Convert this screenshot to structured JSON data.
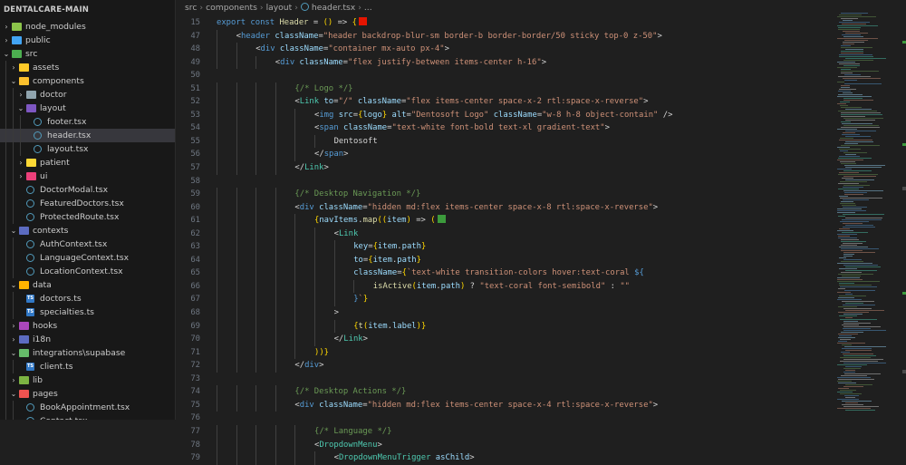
{
  "sidebar": {
    "title": "DENTALCARE-MAIN",
    "items": [
      {
        "label": "node_modules",
        "depth": 0,
        "kind": "folder",
        "open": false,
        "icon": "folder-green-icon",
        "color": "#8bc34a"
      },
      {
        "label": "public",
        "depth": 0,
        "kind": "folder",
        "open": false,
        "icon": "folder-blue-icon",
        "color": "#42a5f5"
      },
      {
        "label": "src",
        "depth": 0,
        "kind": "folder",
        "open": true,
        "icon": "folder-green-icon",
        "color": "#4caf50"
      },
      {
        "label": "assets",
        "depth": 1,
        "kind": "folder",
        "open": false,
        "icon": "folder-yellow-icon",
        "color": "#ffca28"
      },
      {
        "label": "components",
        "depth": 1,
        "kind": "folder",
        "open": true,
        "icon": "folder-yellow-icon",
        "color": "#fbc02d"
      },
      {
        "label": "doctor",
        "depth": 2,
        "kind": "folder",
        "open": false,
        "icon": "folder-grey-icon",
        "color": "#90a4ae"
      },
      {
        "label": "layout",
        "depth": 2,
        "kind": "folder",
        "open": true,
        "icon": "folder-purple-icon",
        "color": "#7e57c2"
      },
      {
        "label": "footer.tsx",
        "depth": 3,
        "kind": "react",
        "icon": "react-icon"
      },
      {
        "label": "header.tsx",
        "depth": 3,
        "kind": "react",
        "icon": "react-icon",
        "selected": true
      },
      {
        "label": "layout.tsx",
        "depth": 3,
        "kind": "react",
        "icon": "react-icon"
      },
      {
        "label": "patient",
        "depth": 2,
        "kind": "folder",
        "open": false,
        "icon": "folder-yellow-icon",
        "color": "#fdd835"
      },
      {
        "label": "ui",
        "depth": 2,
        "kind": "folder",
        "open": false,
        "icon": "folder-pink-icon",
        "color": "#ec407a"
      },
      {
        "label": "DoctorModal.tsx",
        "depth": 2,
        "kind": "react",
        "icon": "react-icon"
      },
      {
        "label": "FeaturedDoctors.tsx",
        "depth": 2,
        "kind": "react",
        "icon": "react-icon"
      },
      {
        "label": "ProtectedRoute.tsx",
        "depth": 2,
        "kind": "react",
        "icon": "react-icon"
      },
      {
        "label": "contexts",
        "depth": 1,
        "kind": "folder",
        "open": true,
        "icon": "folder-blue-icon",
        "color": "#5c6bc0"
      },
      {
        "label": "AuthContext.tsx",
        "depth": 2,
        "kind": "react",
        "icon": "react-icon"
      },
      {
        "label": "LanguageContext.tsx",
        "depth": 2,
        "kind": "react",
        "icon": "react-icon"
      },
      {
        "label": "LocationContext.tsx",
        "depth": 2,
        "kind": "react",
        "icon": "react-icon"
      },
      {
        "label": "data",
        "depth": 1,
        "kind": "folder",
        "open": true,
        "icon": "folder-yellow-icon",
        "color": "#ffb300"
      },
      {
        "label": "doctors.ts",
        "depth": 2,
        "kind": "ts",
        "icon": "typescript-icon"
      },
      {
        "label": "specialties.ts",
        "depth": 2,
        "kind": "ts",
        "icon": "typescript-icon"
      },
      {
        "label": "hooks",
        "depth": 1,
        "kind": "folder",
        "open": false,
        "icon": "folder-purple-icon",
        "color": "#ab47bc"
      },
      {
        "label": "i18n",
        "depth": 1,
        "kind": "folder",
        "open": false,
        "icon": "folder-blue-icon",
        "color": "#5c6bc0"
      },
      {
        "label": "integrations\\supabase",
        "depth": 1,
        "kind": "folder",
        "open": true,
        "icon": "folder-green-icon",
        "color": "#66bb6a"
      },
      {
        "label": "client.ts",
        "depth": 2,
        "kind": "ts",
        "icon": "typescript-icon"
      },
      {
        "label": "lib",
        "depth": 1,
        "kind": "folder",
        "open": false,
        "icon": "folder-green-icon",
        "color": "#7cb342"
      },
      {
        "label": "pages",
        "depth": 1,
        "kind": "folder",
        "open": true,
        "icon": "folder-red-icon",
        "color": "#ef5350"
      },
      {
        "label": "BookAppointment.tsx",
        "depth": 2,
        "kind": "react",
        "icon": "react-icon"
      },
      {
        "label": "Contact.tsx",
        "depth": 2,
        "kind": "react",
        "icon": "react-icon"
      }
    ]
  },
  "breadcrumb": [
    "src",
    "components",
    "layout",
    "header.tsx",
    "..."
  ],
  "colors": {
    "red_swatch": "#e51400",
    "green_swatch": "#3c9b3c"
  },
  "code": [
    {
      "n": "15",
      "indent": 0,
      "tokens": [
        [
          "kw",
          "export "
        ],
        [
          "kw",
          "const "
        ],
        [
          "fn",
          "Header"
        ],
        [
          "pn",
          " = "
        ],
        [
          "br",
          "()"
        ],
        [
          "pn",
          " => "
        ],
        [
          "br",
          "{"
        ],
        [
          "swatch",
          "red"
        ]
      ]
    },
    {
      "n": "47",
      "indent": 1,
      "tokens": [
        [
          "pn",
          "<"
        ],
        [
          "tag",
          "header"
        ],
        [
          "attr",
          " className"
        ],
        [
          "pn",
          "="
        ],
        [
          "str",
          "\"header backdrop-blur-sm border-b border-border/50 sticky top-0 z-50\""
        ],
        [
          "pn",
          ">"
        ]
      ]
    },
    {
      "n": "48",
      "indent": 2,
      "tokens": [
        [
          "pn",
          "<"
        ],
        [
          "tag",
          "div"
        ],
        [
          "attr",
          " className"
        ],
        [
          "pn",
          "="
        ],
        [
          "str",
          "\"container mx-auto px-4\""
        ],
        [
          "pn",
          ">"
        ]
      ]
    },
    {
      "n": "49",
      "indent": 3,
      "tokens": [
        [
          "pn",
          "<"
        ],
        [
          "tag",
          "div"
        ],
        [
          "attr",
          " className"
        ],
        [
          "pn",
          "="
        ],
        [
          "str",
          "\"flex justify-between items-center h-16\""
        ],
        [
          "pn",
          ">"
        ]
      ]
    },
    {
      "n": "50",
      "indent": 0,
      "tokens": []
    },
    {
      "n": "51",
      "indent": 4,
      "tokens": [
        [
          "cm",
          "{/* Logo */}"
        ]
      ]
    },
    {
      "n": "52",
      "indent": 4,
      "tokens": [
        [
          "pn",
          "<"
        ],
        [
          "comp",
          "Link"
        ],
        [
          "attr",
          " to"
        ],
        [
          "pn",
          "="
        ],
        [
          "str",
          "\"/\""
        ],
        [
          "attr",
          " className"
        ],
        [
          "pn",
          "="
        ],
        [
          "str",
          "\"flex items-center space-x-2 rtl:space-x-reverse\""
        ],
        [
          "pn",
          ">"
        ]
      ]
    },
    {
      "n": "53",
      "indent": 5,
      "tokens": [
        [
          "pn",
          "<"
        ],
        [
          "tag",
          "img"
        ],
        [
          "attr",
          " src"
        ],
        [
          "pn",
          "="
        ],
        [
          "br",
          "{"
        ],
        [
          "var",
          "logo"
        ],
        [
          "br",
          "}"
        ],
        [
          "attr",
          " alt"
        ],
        [
          "pn",
          "="
        ],
        [
          "str",
          "\"Dentosoft Logo\""
        ],
        [
          "attr",
          " className"
        ],
        [
          "pn",
          "="
        ],
        [
          "str",
          "\"w-8 h-8 object-contain\""
        ],
        [
          "pn",
          " />"
        ]
      ]
    },
    {
      "n": "54",
      "indent": 5,
      "tokens": [
        [
          "pn",
          "<"
        ],
        [
          "tag",
          "span"
        ],
        [
          "attr",
          " className"
        ],
        [
          "pn",
          "="
        ],
        [
          "str",
          "\"text-white font-bold text-xl gradient-text\""
        ],
        [
          "pn",
          ">"
        ]
      ]
    },
    {
      "n": "55",
      "indent": 6,
      "tokens": [
        [
          "pn",
          "Dentosoft"
        ]
      ]
    },
    {
      "n": "56",
      "indent": 5,
      "tokens": [
        [
          "pn",
          "</"
        ],
        [
          "tag",
          "span"
        ],
        [
          "pn",
          ">"
        ]
      ]
    },
    {
      "n": "57",
      "indent": 4,
      "tokens": [
        [
          "pn",
          "</"
        ],
        [
          "comp",
          "Link"
        ],
        [
          "pn",
          ">"
        ]
      ]
    },
    {
      "n": "58",
      "indent": 0,
      "tokens": []
    },
    {
      "n": "59",
      "indent": 4,
      "tokens": [
        [
          "cm",
          "{/* Desktop Navigation */}"
        ]
      ]
    },
    {
      "n": "60",
      "indent": 4,
      "tokens": [
        [
          "pn",
          "<"
        ],
        [
          "tag",
          "div"
        ],
        [
          "attr",
          " className"
        ],
        [
          "pn",
          "="
        ],
        [
          "str",
          "\"hidden md:flex items-center space-x-8 rtl:space-x-reverse\""
        ],
        [
          "pn",
          ">"
        ]
      ]
    },
    {
      "n": "61",
      "indent": 5,
      "tokens": [
        [
          "br",
          "{"
        ],
        [
          "var",
          "navItems"
        ],
        [
          "pn",
          "."
        ],
        [
          "fn",
          "map"
        ],
        [
          "br",
          "(("
        ],
        [
          "var",
          "item"
        ],
        [
          "br",
          ")"
        ],
        [
          "pn",
          " => "
        ],
        [
          "br",
          "("
        ],
        [
          "swatch",
          "green"
        ]
      ]
    },
    {
      "n": "62",
      "indent": 6,
      "tokens": [
        [
          "pn",
          "<"
        ],
        [
          "comp",
          "Link"
        ]
      ]
    },
    {
      "n": "63",
      "indent": 7,
      "tokens": [
        [
          "attr",
          "key"
        ],
        [
          "pn",
          "="
        ],
        [
          "br",
          "{"
        ],
        [
          "var",
          "item"
        ],
        [
          "pn",
          "."
        ],
        [
          "var",
          "path"
        ],
        [
          "br",
          "}"
        ]
      ]
    },
    {
      "n": "64",
      "indent": 7,
      "tokens": [
        [
          "attr",
          "to"
        ],
        [
          "pn",
          "="
        ],
        [
          "br",
          "{"
        ],
        [
          "var",
          "item"
        ],
        [
          "pn",
          "."
        ],
        [
          "var",
          "path"
        ],
        [
          "br",
          "}"
        ]
      ]
    },
    {
      "n": "65",
      "indent": 7,
      "tokens": [
        [
          "attr",
          "className"
        ],
        [
          "pn",
          "="
        ],
        [
          "br",
          "{"
        ],
        [
          "str",
          "`text-white transition-colors hover:text-coral "
        ],
        [
          "kw",
          "${"
        ]
      ]
    },
    {
      "n": "66",
      "indent": 8,
      "tokens": [
        [
          "fn",
          "isActive"
        ],
        [
          "br",
          "("
        ],
        [
          "var",
          "item"
        ],
        [
          "pn",
          "."
        ],
        [
          "var",
          "path"
        ],
        [
          "br",
          ")"
        ],
        [
          "pn",
          " ? "
        ],
        [
          "str",
          "\"text-coral font-semibold\""
        ],
        [
          "pn",
          " : "
        ],
        [
          "str",
          "\"\""
        ]
      ]
    },
    {
      "n": "67",
      "indent": 7,
      "tokens": [
        [
          "kw",
          "}"
        ],
        [
          "str",
          "`"
        ],
        [
          "br",
          "}"
        ]
      ]
    },
    {
      "n": "68",
      "indent": 6,
      "tokens": [
        [
          "pn",
          ">"
        ]
      ]
    },
    {
      "n": "69",
      "indent": 7,
      "tokens": [
        [
          "br",
          "{"
        ],
        [
          "fn",
          "t"
        ],
        [
          "br",
          "("
        ],
        [
          "var",
          "item"
        ],
        [
          "pn",
          "."
        ],
        [
          "var",
          "label"
        ],
        [
          "br",
          ")}"
        ]
      ]
    },
    {
      "n": "70",
      "indent": 6,
      "tokens": [
        [
          "pn",
          "</"
        ],
        [
          "comp",
          "Link"
        ],
        [
          "pn",
          ">"
        ]
      ]
    },
    {
      "n": "71",
      "indent": 5,
      "tokens": [
        [
          "br",
          "))}"
        ]
      ]
    },
    {
      "n": "72",
      "indent": 4,
      "tokens": [
        [
          "pn",
          "</"
        ],
        [
          "tag",
          "div"
        ],
        [
          "pn",
          ">"
        ]
      ]
    },
    {
      "n": "73",
      "indent": 0,
      "tokens": []
    },
    {
      "n": "74",
      "indent": 4,
      "tokens": [
        [
          "cm",
          "{/* Desktop Actions */}"
        ]
      ]
    },
    {
      "n": "75",
      "indent": 4,
      "tokens": [
        [
          "pn",
          "<"
        ],
        [
          "tag",
          "div"
        ],
        [
          "attr",
          " className"
        ],
        [
          "pn",
          "="
        ],
        [
          "str",
          "\"hidden md:flex items-center space-x-4 rtl:space-x-reverse\""
        ],
        [
          "pn",
          ">"
        ]
      ]
    },
    {
      "n": "76",
      "indent": 0,
      "tokens": []
    },
    {
      "n": "77",
      "indent": 5,
      "tokens": [
        [
          "cm",
          "{/* Language */}"
        ]
      ]
    },
    {
      "n": "78",
      "indent": 5,
      "tokens": [
        [
          "pn",
          "<"
        ],
        [
          "comp",
          "DropdownMenu"
        ],
        [
          "pn",
          ">"
        ]
      ]
    },
    {
      "n": "79",
      "indent": 6,
      "tokens": [
        [
          "pn",
          "<"
        ],
        [
          "comp",
          "DropdownMenuTrigger"
        ],
        [
          "attr",
          " asChild"
        ],
        [
          "pn",
          ">"
        ]
      ]
    }
  ]
}
